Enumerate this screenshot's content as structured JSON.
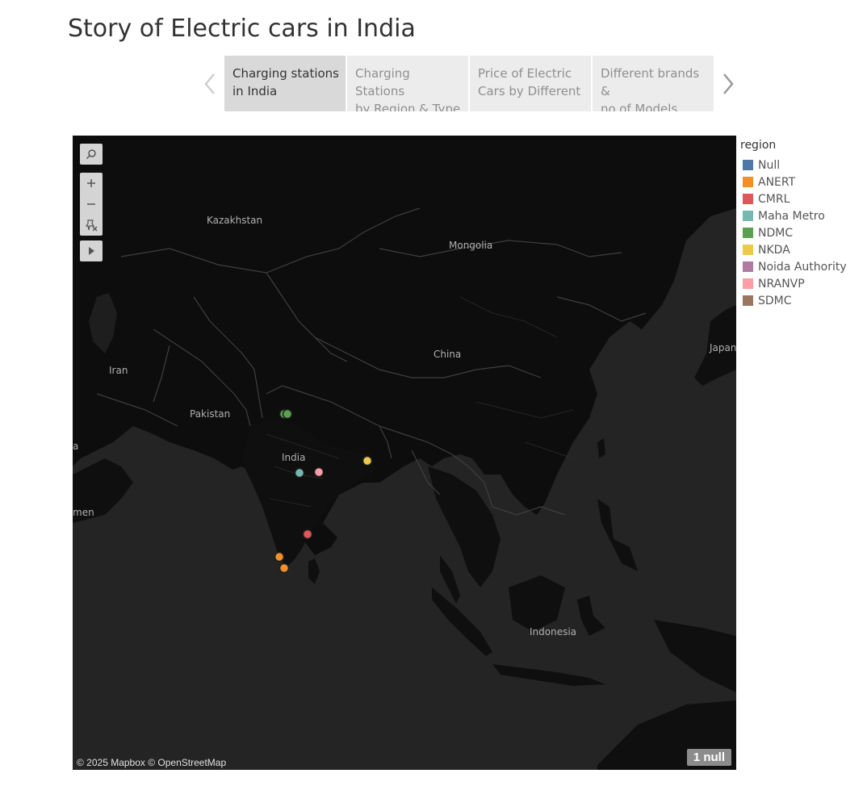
{
  "story": {
    "title": "Story of Electric cars in India",
    "points": [
      {
        "label": "Charging stations\nin India",
        "active": true
      },
      {
        "label": "Charging Stations\nby Region & Type",
        "active": false
      },
      {
        "label": "Price of Electric\nCars by Different",
        "active": false
      },
      {
        "label": "Different brands &\nno.of Models",
        "active": false
      }
    ]
  },
  "map": {
    "labels": {
      "kazakhstan": "Kazakhstan",
      "mongolia": "Mongolia",
      "iran": "Iran",
      "china": "China",
      "japan": "Japan",
      "pakistan": "Pakistan",
      "india": "India",
      "indonesia": "Indonesia",
      "yemen": "men",
      "africa_edge": "a"
    },
    "attribution": "© 2025 Mapbox © OpenStreetMap",
    "null_badge": "1 null",
    "markers": [
      {
        "region": "NDMC",
        "place": "Delhi",
        "color": "#59a14f"
      },
      {
        "region": "NDMC",
        "place": "Delhi",
        "color": "#59a14f"
      },
      {
        "region": "Maha Metro",
        "place": "Nagpur",
        "color": "#76b7b2"
      },
      {
        "region": "NRANVP",
        "place": "Raipur",
        "color": "#ff9da7"
      },
      {
        "region": "NKDA",
        "place": "Kolkata",
        "color": "#edc948"
      },
      {
        "region": "CMRL",
        "place": "Chennai",
        "color": "#e15759"
      },
      {
        "region": "ANERT",
        "place": "Kerala",
        "color": "#f28e2b"
      },
      {
        "region": "ANERT",
        "place": "Kerala",
        "color": "#f28e2b"
      }
    ]
  },
  "legend": {
    "title": "region",
    "items": [
      {
        "label": "Null",
        "color": "#4e79a7"
      },
      {
        "label": "ANERT",
        "color": "#f28e2b"
      },
      {
        "label": "CMRL",
        "color": "#e15759"
      },
      {
        "label": "Maha Metro",
        "color": "#76b7b2"
      },
      {
        "label": "NDMC",
        "color": "#59a14f"
      },
      {
        "label": "NKDA",
        "color": "#edc948"
      },
      {
        "label": "Noida Authority",
        "color": "#b07aa1"
      },
      {
        "label": "NRANVP",
        "color": "#ff9da7"
      },
      {
        "label": "SDMC",
        "color": "#9c755f"
      }
    ]
  }
}
